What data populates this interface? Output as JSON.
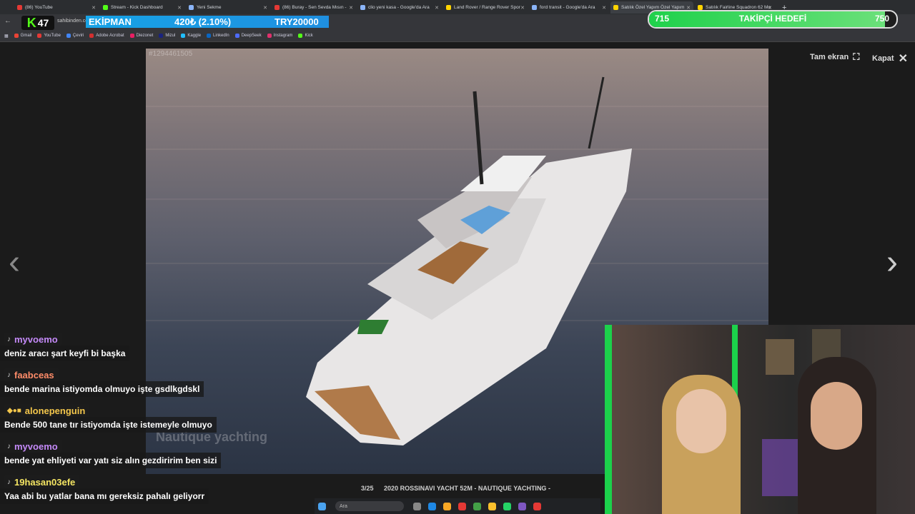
{
  "browser": {
    "tabs": [
      {
        "label": "(86) YouTube",
        "color": "#e53935"
      },
      {
        "label": "Stream - Kick Dashboard",
        "color": "#53fc18"
      },
      {
        "label": "Yeni Sekme",
        "color": "#8ab4f8"
      },
      {
        "label": "(86) Buray - Sen Sevda Mısın -",
        "color": "#e53935"
      },
      {
        "label": "clio yeni kasa - Google'da Ara",
        "color": "#8ab4f8"
      },
      {
        "label": "Land Rover / Range Rover Spor",
        "color": "#ffd400"
      },
      {
        "label": "ford transit - Google'da Ara",
        "color": "#8ab4f8"
      },
      {
        "label": "Satılık Özel Yapım Özel Yapım",
        "color": "#ffd400"
      },
      {
        "label": "Satılık Fairline Squadron 62 Mo",
        "color": "#ffd400"
      }
    ],
    "address": "sahibinden.com",
    "bookmarks": [
      "Gmail",
      "YouTube",
      "Çeviri",
      "Adobe Acrobat",
      "Diezonet",
      "Mizul",
      "Kaggle",
      "LinkedIn",
      "DeepSeek",
      "Instagram",
      "Kick"
    ]
  },
  "overlay": {
    "viewers": "47",
    "ticker_name": "EKİPMAN",
    "ticker_change": "420₺ (2.10%)",
    "ticker_price": "TRY20000",
    "goal_current": "715",
    "goal_label": "TAKİPÇİ HEDEFİ",
    "goal_target": "750",
    "goal_progress": 0.953
  },
  "viewer": {
    "photo_id": "#1294461505",
    "fullscreen_label": "Tam ekran",
    "close_label": "Kapat",
    "counter": "3/25",
    "caption": "2020 ROSSINAVI YACHT 52M - NAUTIQUE YACHTING -",
    "watermark": "Nautique yachting"
  },
  "chat": [
    {
      "user": "myvoemo",
      "color": "#c58af9",
      "text": "deniz aracı şart keyfi bi başka"
    },
    {
      "user": "faabceas",
      "color": "#ff8c69",
      "text": "bende marina istiyomda olmuyo işte gsdlkgdskl"
    },
    {
      "user": "alonepenguin",
      "color": "#f3c64b",
      "text": "Bende 500 tane tır istiyomda işte istemeyle olmuyo"
    },
    {
      "user": "myvoemo",
      "color": "#c58af9",
      "text": "bende yat ehliyeti var yatı siz alın gezdiririm ben sizi"
    },
    {
      "user": "19hasan03efe",
      "color": "#f5e663",
      "text": "Yaa abi bu yatlar bana mı gereksiz pahalı geliyorr"
    }
  ],
  "taskbar": {
    "search_placeholder": "Ara"
  }
}
